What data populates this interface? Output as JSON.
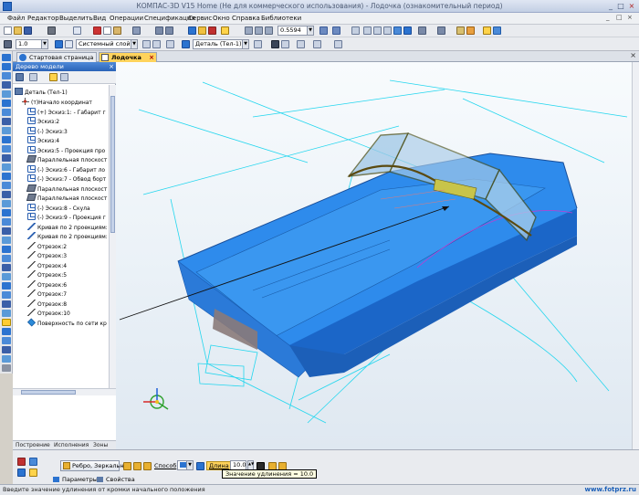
{
  "window": {
    "title": "КОМПАС-3D V15 Home (Не для коммерческого использования) - Лодочка (ознакомительный период)",
    "controls": [
      "_",
      "□",
      "×"
    ]
  },
  "menu": {
    "items": [
      "Файл",
      "Редактор",
      "Выделить",
      "Вид",
      "Операции",
      "Спецификация",
      "Сервис",
      "Окно",
      "Справка",
      "Библиотеки"
    ],
    "mdi_controls": [
      "_",
      "□",
      "×"
    ]
  },
  "toolbar1": {
    "zoom_value": "0.5594"
  },
  "toolbar2": {
    "line_scale": "1.0",
    "layer": "Системный слой (0)",
    "detail": "Деталь (Тел-1)"
  },
  "doc_tabs": [
    {
      "label": "Стартовая страница",
      "active": false
    },
    {
      "label": "Лодочка",
      "active": true
    }
  ],
  "tree_panel": {
    "title": "Дерево модели",
    "root": "Деталь (Тел-1)",
    "items": [
      {
        "label": "(т)Начало координат",
        "icon": "origin-icon"
      },
      {
        "label": "(+) Эскиз:1: - Габарит г",
        "icon": "sketch-icon"
      },
      {
        "label": "Эскиз:2",
        "icon": "sketch-icon"
      },
      {
        "label": "(-) Эскиз:3",
        "icon": "sketch-icon"
      },
      {
        "label": "Эскиз:4",
        "icon": "sketch-icon"
      },
      {
        "label": "Эскиз:5 - Проекция про",
        "icon": "sketch-icon"
      },
      {
        "label": "Параллельная плоскост",
        "icon": "plane-icon"
      },
      {
        "label": "(-) Эскиз:6 - Габарит ло",
        "icon": "sketch-icon"
      },
      {
        "label": "(-) Эскиз:7 - Обвод борт",
        "icon": "sketch-icon"
      },
      {
        "label": "Параллельная плоскост",
        "icon": "plane-icon"
      },
      {
        "label": "Параллельная плоскост",
        "icon": "plane-icon"
      },
      {
        "label": "(-) Эскиз:8 - Скула",
        "icon": "sketch-icon"
      },
      {
        "label": "(-) Эскиз:9 - Проекция г",
        "icon": "sketch-icon"
      },
      {
        "label": "Кривая по 2 проекциям:",
        "icon": "curve-icon"
      },
      {
        "label": "Кривая по 2 проекциям:",
        "icon": "curve-icon"
      },
      {
        "label": "Отрезок:2",
        "icon": "segment-icon"
      },
      {
        "label": "Отрезок:3",
        "icon": "segment-icon"
      },
      {
        "label": "Отрезок:4",
        "icon": "segment-icon"
      },
      {
        "label": "Отрезок:5",
        "icon": "segment-icon"
      },
      {
        "label": "Отрезок:6",
        "icon": "segment-icon"
      },
      {
        "label": "Отрезок:7",
        "icon": "segment-icon"
      },
      {
        "label": "Отрезок:8",
        "icon": "segment-icon"
      },
      {
        "label": "Отрезок:10",
        "icon": "segment-icon"
      },
      {
        "label": "Поверхность по сети кр",
        "icon": "surface-icon"
      }
    ],
    "bottom_tabs": [
      "Построение",
      "Исполнения",
      "Зоны"
    ]
  },
  "properties": {
    "button1": "Ребро, Зеркальн",
    "method_label": "Способ",
    "length_label": "Длина",
    "length_value": "10.0",
    "tooltip": "Значение удлинения = 10.0",
    "tabs": [
      "Параметры",
      "Свойства"
    ]
  },
  "status": {
    "text": "Введите значение удлинения от кромки начального положения",
    "watermark": "www.fotprz.ru"
  },
  "colors": {
    "accent": "#2a63b8",
    "hull": "#2e8bec",
    "hull_dark": "#1b66c8",
    "frame": "#4a4f1a",
    "construction": "#23d6ee",
    "axis_x": "#d62828",
    "axis_y": "#2ca02c",
    "axis_z": "#1f5fd6"
  }
}
